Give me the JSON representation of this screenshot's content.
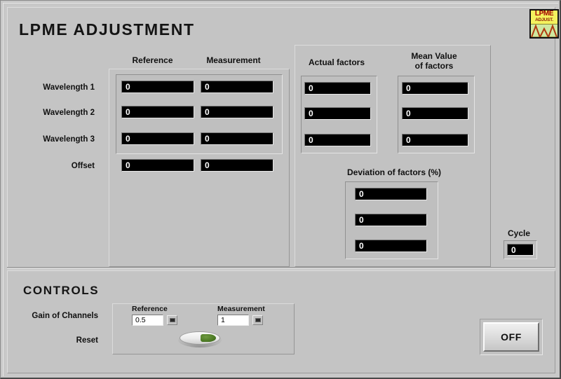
{
  "window": {
    "title": "LPME ADJUSTMENT"
  },
  "logo": {
    "line1": "LPME",
    "line2": "ADJUST.",
    "icon_name": "lpme-adjust-logo-icon"
  },
  "adjustment": {
    "title": "LPME ADJUSTMENT",
    "row_labels": [
      "Wavelength 1",
      "Wavelength 2",
      "Wavelength 3",
      "Offset"
    ],
    "columns": [
      {
        "header": "Reference",
        "values": [
          "0",
          "0",
          "0",
          "0"
        ]
      },
      {
        "header": "Measurement",
        "values": [
          "0",
          "0",
          "0",
          "0"
        ]
      }
    ]
  },
  "factors": {
    "columns": [
      {
        "header": "Actual factors",
        "header_line1": "Actual factors",
        "header_line2": "",
        "values": [
          "0",
          "0",
          "0"
        ]
      },
      {
        "header": "Mean Value of factors",
        "header_line1": "Mean Value",
        "header_line2": "of factors",
        "values": [
          "0",
          "0",
          "0"
        ]
      }
    ],
    "deviation": {
      "header": "Deviation of factors (%)",
      "values": [
        "0",
        "0",
        "0"
      ]
    }
  },
  "cycle": {
    "label": "Cycle",
    "value": "0"
  },
  "controls": {
    "title": "CONTROLS",
    "gain": {
      "label": "Gain of Channels",
      "fields": [
        {
          "label": "Reference",
          "value": "0.5"
        },
        {
          "label": "Measurement",
          "value": "1"
        }
      ]
    },
    "reset": {
      "label": "Reset",
      "switch_name": "reset-rocker-switch",
      "state": "on"
    },
    "power": {
      "label": "OFF"
    }
  },
  "colors": {
    "panel": "#c4c4c4",
    "indicator_bg": "#000000",
    "indicator_text": "#ffffff",
    "led_green": "#4c7a24",
    "logo_yellow": "#f2f06a"
  }
}
